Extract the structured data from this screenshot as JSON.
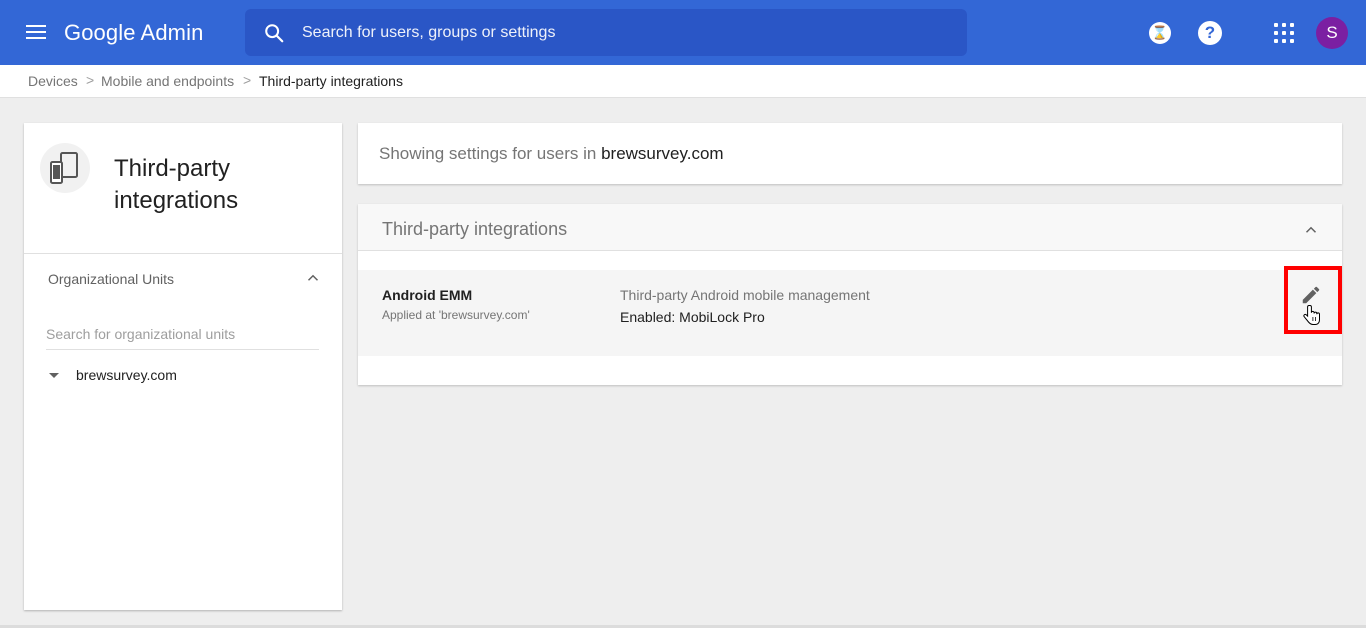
{
  "app": {
    "title": "Google Admin"
  },
  "search": {
    "placeholder": "Search for users, groups or settings"
  },
  "header": {
    "icons": [
      "menu-icon",
      "search-icon",
      "hourglass-icon",
      "help-icon",
      "apps-icon"
    ],
    "hourglass_glyph": "⌛",
    "help_glyph": "?",
    "avatar_initial": "S",
    "colors": {
      "bar": "#3367d6",
      "search": "#2a56c6",
      "avatar": "#7b1fa2"
    }
  },
  "breadcrumb": {
    "items": [
      "Devices",
      "Mobile and endpoints",
      "Third-party integrations"
    ],
    "separator": ">"
  },
  "left_panel": {
    "title": "Third-party integrations",
    "icon": "devices-icon",
    "org_units_label": "Organizational Units",
    "org_search_placeholder": "Search for organizational units",
    "org_root": "brewsurvey.com"
  },
  "info": {
    "prefix": "Showing settings for users in",
    "domain": "brewsurvey.com"
  },
  "settings": {
    "section_title": "Third-party integrations",
    "rows": [
      {
        "name": "Android EMM",
        "applied": "Applied at 'brewsurvey.com'",
        "description": "Third-party Android mobile management",
        "value": "Enabled: MobiLock Pro"
      }
    ],
    "highlight_color": "#ff0000"
  }
}
